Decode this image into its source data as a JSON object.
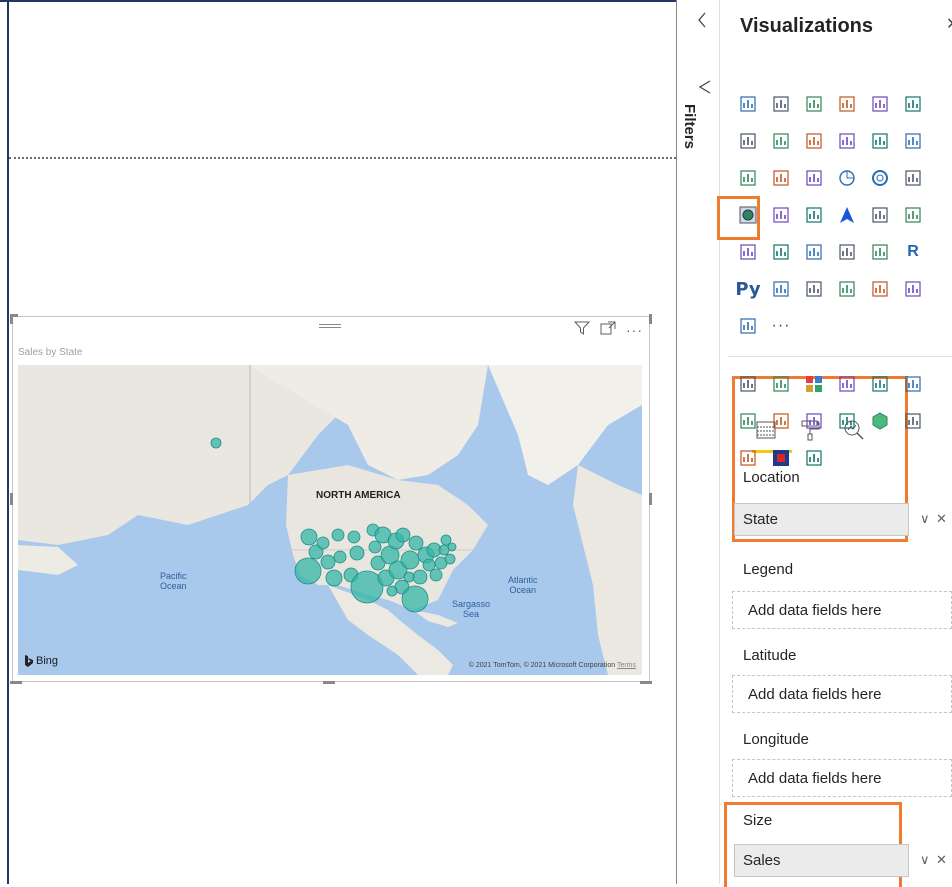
{
  "canvas": {
    "visual": {
      "title": "Sales by State",
      "map": {
        "labels": {
          "north_america": "NORTH AMERICA",
          "pacific": "Pacific\nOcean",
          "atlantic": "Atlantic\nOcean",
          "sargasso": "Sargasso\nSea"
        },
        "bing": "Bing",
        "copyright": "© 2021 TomTom, © 2021 Microsoft Corporation",
        "terms": "Terms"
      }
    }
  },
  "filters": {
    "label": "Filters"
  },
  "visualizations": {
    "title": "Visualizations",
    "colors": {
      "highlight": "#ee7b2e",
      "accent": "#f2c811",
      "bubble": "#36b6a8"
    },
    "wells": {
      "location": {
        "label": "Location",
        "value": "State"
      },
      "legend": {
        "label": "Legend",
        "placeholder": "Add data fields here"
      },
      "latitude": {
        "label": "Latitude",
        "placeholder": "Add data fields here"
      },
      "longitude": {
        "label": "Longitude",
        "placeholder": "Add data fields here"
      },
      "size": {
        "label": "Size",
        "value": "Sales"
      }
    },
    "more_glyph": "···"
  }
}
